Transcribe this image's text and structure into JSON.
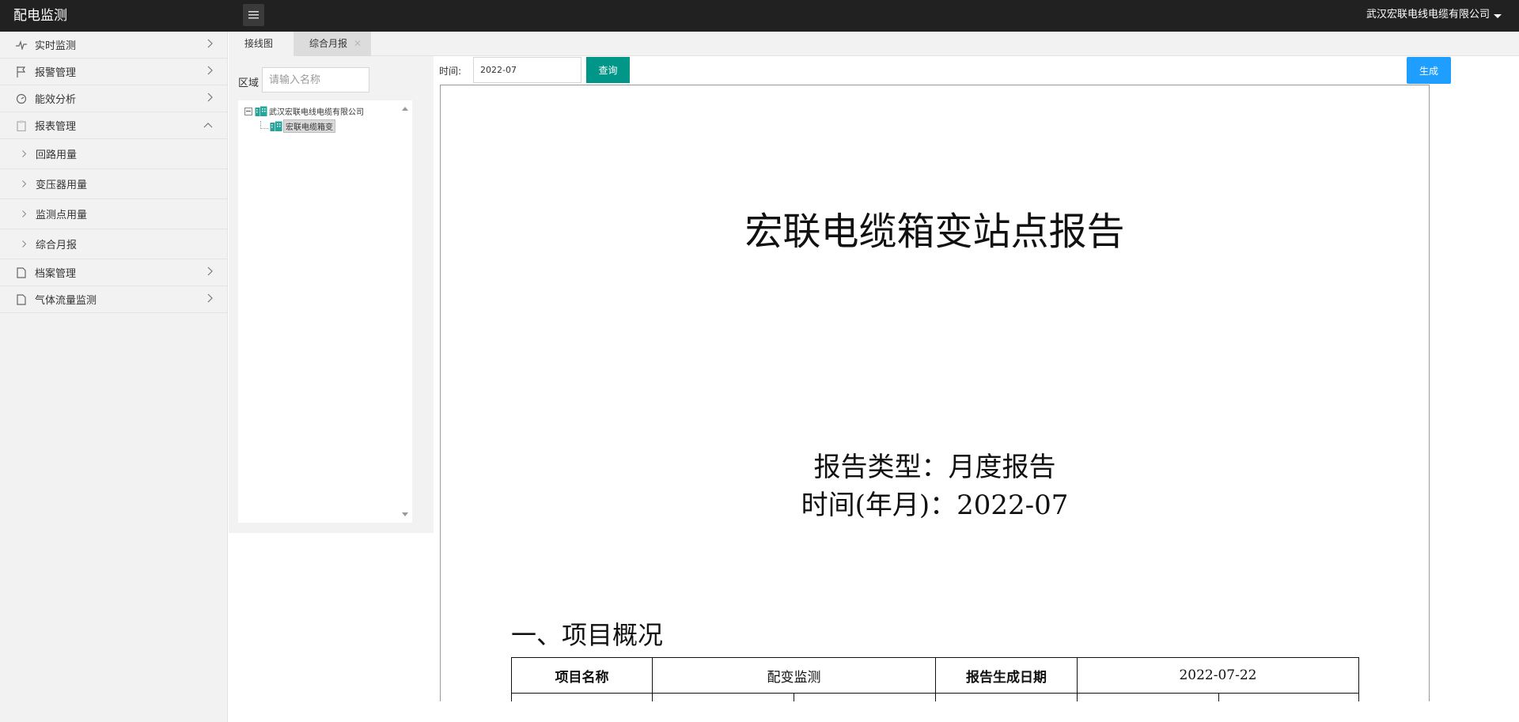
{
  "header": {
    "app_title": "配电监测",
    "company": "武汉宏联电线电缆有限公司"
  },
  "sidebar": {
    "items": [
      {
        "label": "实时监测"
      },
      {
        "label": "报警管理"
      },
      {
        "label": "能效分析"
      },
      {
        "label": "报表管理"
      },
      {
        "label": "档案管理"
      },
      {
        "label": "气体流量监测"
      }
    ],
    "sub_items": [
      {
        "label": "回路用量"
      },
      {
        "label": "变压器用量"
      },
      {
        "label": "监测点用量"
      },
      {
        "label": "综合月报"
      }
    ]
  },
  "tabs": [
    {
      "label": "接线图"
    },
    {
      "label": "综合月报"
    }
  ],
  "tree": {
    "area_label": "区域",
    "search_placeholder": "请输入名称",
    "root": "武汉宏联电线电缆有限公司",
    "child": "宏联电缆箱变"
  },
  "query": {
    "time_label": "时间:",
    "time_value": "2022-07",
    "query_label": "查询",
    "generate_label": "生成"
  },
  "report": {
    "title": "宏联电缆箱变站点报告",
    "type_line": "报告类型：月度报告",
    "time_line": "时间(年月)：2022-07",
    "section1": "一、项目概况",
    "table": {
      "project_name_label": "项目名称",
      "project_name_value": "配变监测",
      "date_label": "报告生成日期",
      "date_value": "2022-07-22"
    }
  },
  "colors": {
    "header_bg": "#212121",
    "query_button": "#009688",
    "generate_button": "#1e9fff"
  }
}
